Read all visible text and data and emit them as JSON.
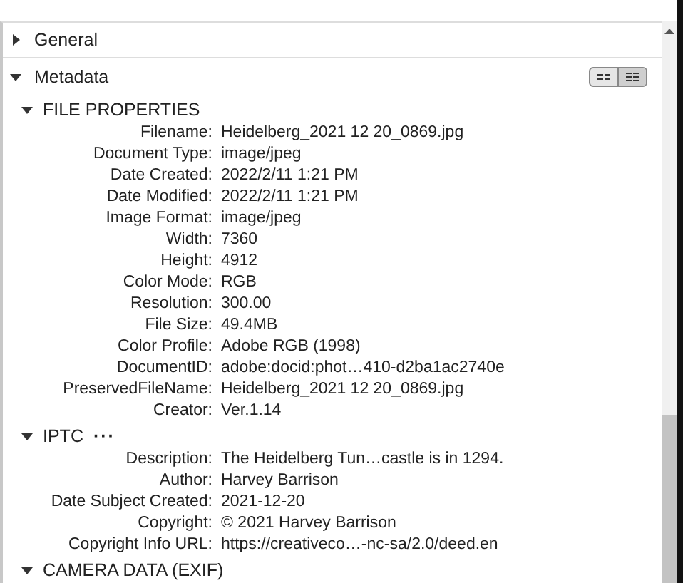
{
  "sections": [
    {
      "label": "General",
      "expanded": false
    },
    {
      "label": "Metadata",
      "expanded": true,
      "view_toggle": [
        {
          "selected": false
        },
        {
          "selected": true
        }
      ]
    }
  ],
  "groups": [
    {
      "title": "FILE PROPERTIES",
      "expanded": true,
      "rows": [
        {
          "label": "Filename:",
          "value": "Heidelberg_2021 12 20_0869.jpg"
        },
        {
          "label": "Document Type:",
          "value": "image/jpeg"
        },
        {
          "label": "Date Created:",
          "value": "2022/2/11 1:21 PM"
        },
        {
          "label": "Date Modified:",
          "value": "2022/2/11 1:21 PM"
        },
        {
          "label": "Image Format:",
          "value": "image/jpeg"
        },
        {
          "label": "Width:",
          "value": "7360"
        },
        {
          "label": "Height:",
          "value": "4912"
        },
        {
          "label": "Color Mode:",
          "value": "RGB"
        },
        {
          "label": "Resolution:",
          "value": "300.00"
        },
        {
          "label": "File Size:",
          "value": "49.4MB"
        },
        {
          "label": "Color Profile:",
          "value": "Adobe RGB (1998)"
        },
        {
          "label": "DocumentID:",
          "value": "adobe:docid:phot…410-d2ba1ac2740e"
        },
        {
          "label": "PreservedFileName:",
          "value": "Heidelberg_2021 12 20_0869.jpg"
        },
        {
          "label": "Creator:",
          "value": "Ver.1.14"
        }
      ]
    },
    {
      "title": "IPTC",
      "more": "···",
      "expanded": true,
      "rows": [
        {
          "label": "Description:",
          "value": "The Heidelberg Tun…castle is in 1294."
        },
        {
          "label": "Author:",
          "value": "Harvey Barrison"
        },
        {
          "label": "Date Subject Created:",
          "value": "2021-12-20"
        },
        {
          "label": "Copyright:",
          "value": "© 2021 Harvey Barrison"
        },
        {
          "label": "Copyright Info URL:",
          "value": "https://creativeco…-nc-sa/2.0/deed.en"
        }
      ]
    },
    {
      "title": "CAMERA DATA (EXIF)",
      "expanded": true
    }
  ]
}
